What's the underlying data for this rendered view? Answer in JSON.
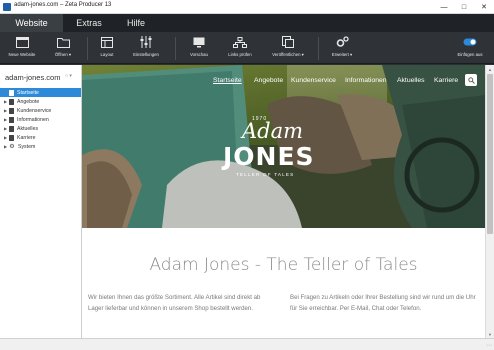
{
  "window": {
    "title": "adam-jones.com – Zeta Producer 13"
  },
  "tabs": [
    {
      "label": "Website"
    },
    {
      "label": "Extras"
    },
    {
      "label": "Hilfe"
    }
  ],
  "ribbon": [
    {
      "label": "Neue Website",
      "icon": "window-new-icon"
    },
    {
      "label": "Öffnen ▾",
      "icon": "folder-open-icon"
    },
    {
      "label": "Layout",
      "icon": "layout-icon"
    },
    {
      "label": "Einstellungen",
      "icon": "sliders-icon"
    },
    {
      "label": "Vorschau",
      "icon": "monitor-icon"
    },
    {
      "label": "Links prüfen",
      "icon": "sitemap-icon"
    },
    {
      "label": "Veröffentlichen ▾",
      "icon": "publish-icon"
    },
    {
      "label": "Erweitert ▾",
      "icon": "gears-icon"
    },
    {
      "label": "Einfügen aus",
      "icon": "toggle-icon"
    }
  ],
  "sidebar": {
    "site_name": "adam-jones.com",
    "dropdown_glyph": "○ ▾",
    "items": [
      {
        "label": "Startseite",
        "selected": true,
        "icon": "page-icon",
        "expandable": false
      },
      {
        "label": "Angebote",
        "selected": false,
        "icon": "page-icon",
        "expandable": true
      },
      {
        "label": "Kundenservice",
        "selected": false,
        "icon": "page-icon",
        "expandable": true
      },
      {
        "label": "Informationen",
        "selected": false,
        "icon": "page-icon",
        "expandable": true
      },
      {
        "label": "Aktuelles",
        "selected": false,
        "icon": "page-icon",
        "expandable": true
      },
      {
        "label": "Karriere",
        "selected": false,
        "icon": "page-icon",
        "expandable": true
      },
      {
        "label": "System",
        "selected": false,
        "icon": "gear-icon",
        "expandable": true
      }
    ]
  },
  "preview": {
    "nav": [
      {
        "label": "Startseite",
        "current": true
      },
      {
        "label": "Angebote",
        "current": false
      },
      {
        "label": "Kundenservice",
        "current": false
      },
      {
        "label": "Informationen",
        "current": false
      },
      {
        "label": "Aktuelles",
        "current": false
      },
      {
        "label": "Karriere",
        "current": false
      }
    ],
    "logo": {
      "since": "1970",
      "script": "Adam",
      "main": "JONES",
      "tagline": "TELLER OF TALES"
    },
    "headline": "Adam Jones - The Teller of Tales",
    "col_left": "Wir bieten Ihnen das größte Sortiment. Alle Artikel sind direkt ab Lager lieferbar und können in unserem Shop bestellt werden.",
    "col_right": "Bei Fragen zu Artikeln oder Ihrer Bestellung sind wir rund um die Uhr für Sie erreichbar. Per E-Mail, Chat oder Telefon."
  },
  "colors": {
    "selection": "#2c8ad8",
    "ribbon_bg": "#2f3338",
    "tabbar_bg": "#1f2226"
  }
}
